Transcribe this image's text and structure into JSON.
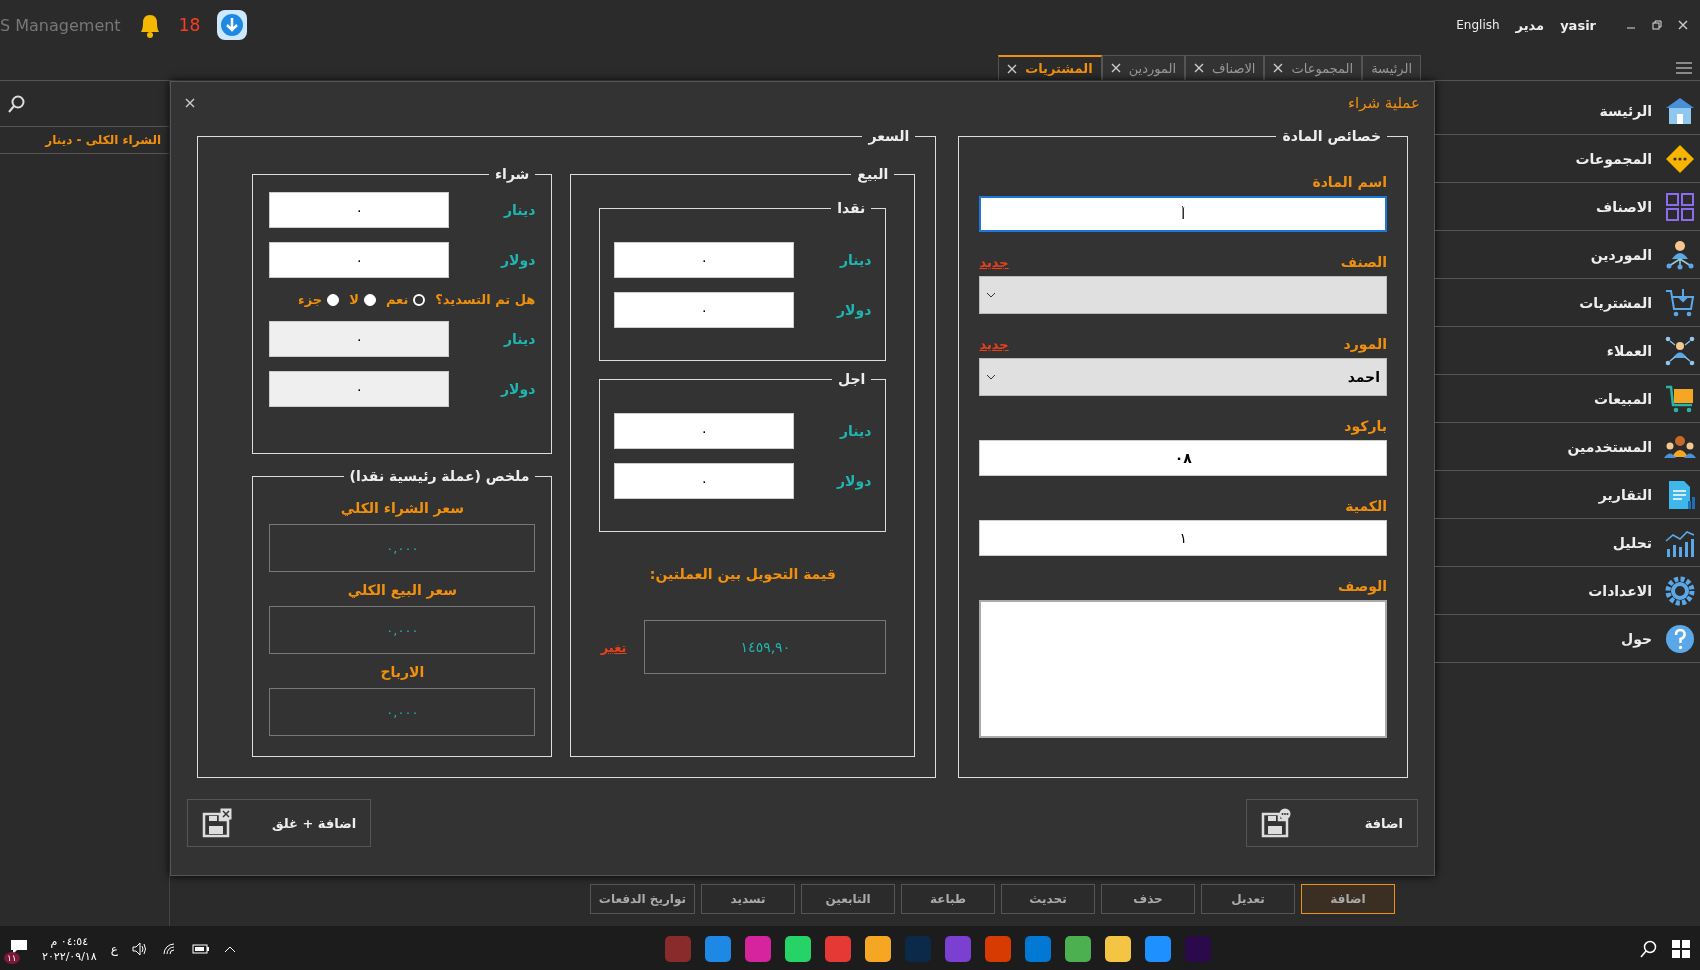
{
  "app_bar": {
    "title": "S Management",
    "notifications": "18",
    "language": "English",
    "role": "مدير",
    "user": "yasir"
  },
  "tabs": [
    {
      "label": "الرئيسة",
      "selected": false,
      "closable": false
    },
    {
      "label": "المجموعات",
      "selected": false,
      "closable": true
    },
    {
      "label": "الاصناف",
      "selected": false,
      "closable": true
    },
    {
      "label": "الموردين",
      "selected": false,
      "closable": true
    },
    {
      "label": "المشتريات",
      "selected": true,
      "closable": true
    }
  ],
  "left_panel": {
    "column_header": "الشراء الكلى - دينار"
  },
  "sidebar": {
    "items": [
      {
        "label": "الرئيسة",
        "kind": "home"
      },
      {
        "label": "المجموعات",
        "kind": "groups"
      },
      {
        "label": "الاصناف",
        "kind": "categories"
      },
      {
        "label": "الموردين",
        "kind": "suppliers"
      },
      {
        "label": "المشتريات",
        "kind": "purchases"
      },
      {
        "label": "العملاء",
        "kind": "customers"
      },
      {
        "label": "المبيعات",
        "kind": "sales"
      },
      {
        "label": "المستخدمين",
        "kind": "users"
      },
      {
        "label": "التقارير",
        "kind": "reports"
      },
      {
        "label": "تحليل",
        "kind": "analysis"
      },
      {
        "label": "الاعدادات",
        "kind": "settings"
      },
      {
        "label": "حول",
        "kind": "about"
      }
    ]
  },
  "dialog": {
    "title": "عملية شراء",
    "item_group": {
      "legend": "خصائص المادة",
      "fields": [
        {
          "kind": "text",
          "label": "اسم المادة",
          "value": "أ",
          "focused": true
        },
        {
          "kind": "select",
          "label": "الصنف",
          "link": "جديد"
        },
        {
          "kind": "select",
          "label": "المورد",
          "link": "جديد",
          "value": "احمد"
        },
        {
          "kind": "text",
          "label": "باركود",
          "value": "٠٨",
          "bold": true
        },
        {
          "kind": "text",
          "label": "الكمية",
          "value": "١"
        },
        {
          "kind": "textarea",
          "label": "الوصف"
        }
      ]
    },
    "price_group": {
      "legend": "السعر",
      "sell": {
        "legend": "البيع",
        "groups": [
          {
            "legend": "نقدا",
            "rows": [
              {
                "currency": "دينار",
                "value": "٠"
              },
              {
                "currency": "دولار",
                "value": "٠"
              }
            ]
          },
          {
            "legend": "اجل",
            "rows": [
              {
                "currency": "دينار",
                "value": "٠"
              },
              {
                "currency": "دولار",
                "value": "٠"
              }
            ]
          }
        ],
        "rate_label": "قيمة التحويل بين العملتين:",
        "rate_value": "١٤٥٩,٩٠",
        "rate_link": "تغير"
      },
      "buy": {
        "legend": "شراء",
        "rows": [
          {
            "currency": "دينار",
            "value": "٠",
            "disabled": false
          },
          {
            "currency": "دولار",
            "value": "٠",
            "disabled": false
          }
        ],
        "question": "هل تم التسديد؟",
        "options": [
          {
            "label": "نعم",
            "selected": true
          },
          {
            "label": "لا",
            "selected": false
          },
          {
            "label": "جزء",
            "selected": false
          }
        ],
        "paid_rows": [
          {
            "currency": "دينار",
            "value": "٠",
            "disabled": true
          },
          {
            "currency": "دولار",
            "value": "٠",
            "disabled": true
          }
        ]
      },
      "summary": {
        "legend": "ملخص (عملة رئيسية نقدا)",
        "items": [
          {
            "label": "سعر الشراء الكلي",
            "value": "٠,٠٠٠"
          },
          {
            "label": "سعر البيع الكلي",
            "value": "٠,٠٠٠"
          },
          {
            "label": "الارباح",
            "value": "٠,٠٠٠"
          }
        ]
      }
    },
    "buttons": [
      {
        "label": "اضافة",
        "kind": "add"
      },
      {
        "label": "اضافة + غلق",
        "kind": "add_close"
      }
    ]
  },
  "bottom_buttons": [
    {
      "label": "اضافة",
      "selected": true
    },
    {
      "label": "تعديل",
      "selected": false
    },
    {
      "label": "حذف",
      "selected": false
    },
    {
      "label": "تحديث",
      "selected": false
    },
    {
      "label": "طباعة",
      "selected": false
    },
    {
      "label": "التابعين",
      "selected": false
    },
    {
      "label": "تسديد",
      "selected": false
    },
    {
      "label": "تواريخ الدفعات",
      "selected": false
    }
  ],
  "taskbar": {
    "time": "٠٤:٥٤ م",
    "date": "٢٠٢٢/٠٩/١٨",
    "language": "ع",
    "notification_count": "١١"
  }
}
